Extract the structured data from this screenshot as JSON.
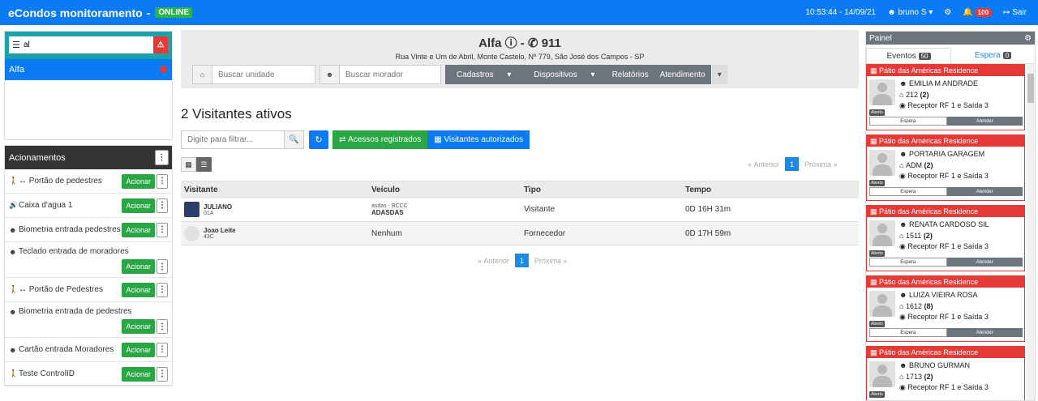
{
  "topbar": {
    "title": "eCondos monitoramento",
    "title_sep": "-",
    "status": "ONLINE",
    "datetime": "10:53:44 - 14/09/21",
    "user": "bruno S",
    "notifications": "100",
    "logout": "Sair"
  },
  "sidebar": {
    "search_value": "al",
    "unit": "Alfa"
  },
  "acionamentos": {
    "title": "Acionamentos",
    "button_label": "Acionar",
    "items": [
      {
        "label": "↔ Portão de pedestres",
        "icon": "walk-icon"
      },
      {
        "label": "Caixa d'agua 1",
        "icon": "volume-icon"
      },
      {
        "label": "Biometria entrada pedestres",
        "icon": "user-icon"
      },
      {
        "label": "Teclado entrada de moradores",
        "icon": "user-icon"
      },
      {
        "label": "↔ Portão de Pedestres",
        "icon": "walk-icon"
      },
      {
        "label": "Biometria entrada de pedestres",
        "icon": "user-icon"
      },
      {
        "label": "Cartão entrada Moradores",
        "icon": "user-icon"
      },
      {
        "label": "Teste ControlID",
        "icon": "walk-icon"
      }
    ]
  },
  "header": {
    "name": "Alfa",
    "dash": "-",
    "phone": "911",
    "address": "Rua Vinte e Um de Abril, Monte Castelo, Nº 779, São José dos Campos - SP",
    "unit_placeholder": "Buscar unidade",
    "resident_placeholder": "Buscar morador",
    "menu": {
      "cadastros": "Cadastros",
      "dispositivos": "Dispositivos",
      "relatorios": "Relatórios",
      "atendimento": "Atendimento"
    }
  },
  "visitors": {
    "title": "2 Visitantes ativos",
    "filter_placeholder": "Digite para filtrar...",
    "btn_registered": "Acessos registrados",
    "btn_authorized": "Visitantes autorizados",
    "pager": {
      "prev": "Anterior",
      "page": "1",
      "next": "Próxima"
    },
    "columns": [
      "Visitante",
      "Veículo",
      "Tipo",
      "Tempo"
    ],
    "rows": [
      {
        "name": "JULIANO",
        "unit": "01A",
        "vehicle_line1": "asdas - BCCC",
        "vehicle_line2": "ADASDAS",
        "type": "Visitante",
        "time": "0D 16H 31m"
      },
      {
        "name": "Joao Leite",
        "unit": "43C",
        "vehicle_line1": "Nenhum",
        "vehicle_line2": "",
        "type": "Fornecedor",
        "time": "0D 17H 59m"
      }
    ]
  },
  "panel": {
    "title": "Painel",
    "tab_events": "Eventos",
    "events_count": "50",
    "tab_wait": "Espera",
    "wait_count": "0",
    "status_label": "Aberto",
    "btn_wait": "Espera",
    "btn_attend": "Atender",
    "events": [
      {
        "place": "Pátio das Américas Residence",
        "name": "EMILIA M ANDRADE",
        "unit": "212",
        "count": "(2)",
        "receiver": "Receptor RF 1 e Saída 3"
      },
      {
        "place": "Pátio das Américas Residence",
        "name": "PORTARIA GARAGEM",
        "unit": "ADM",
        "count": "(2)",
        "receiver": "Receptor RF 1 e Saída 3"
      },
      {
        "place": "Pátio das Américas Residence",
        "name": "RENATA CARDOSO SIL",
        "unit": "1511",
        "count": "(2)",
        "receiver": "Receptor RF 1 e Saída 3"
      },
      {
        "place": "Pátio das Américas Residence",
        "name": "LUIZA VIEIRA ROSA",
        "unit": "1612",
        "count": "(8)",
        "receiver": "Receptor RF 1 e Saída 3"
      },
      {
        "place": "Pátio das Américas Residence",
        "name": "BRUNO GURMAN",
        "unit": "1713",
        "count": "(2)",
        "receiver": "Receptor RF 1 e Saída 3"
      }
    ]
  }
}
